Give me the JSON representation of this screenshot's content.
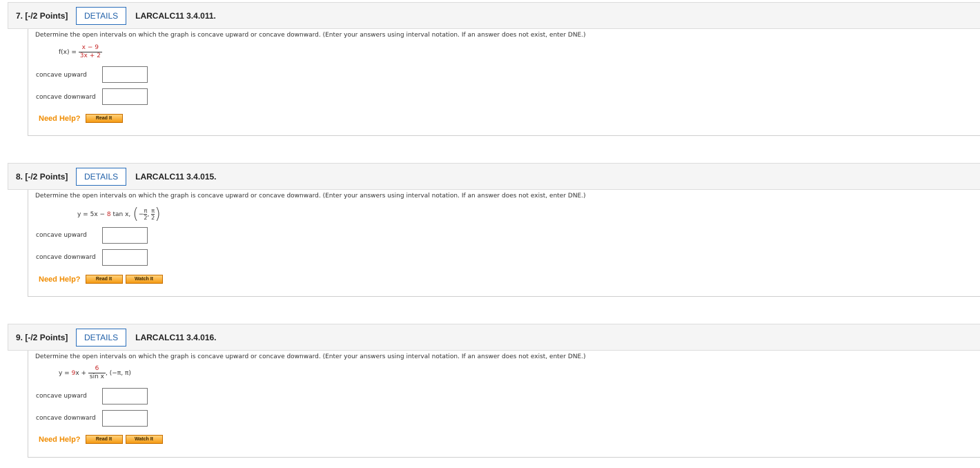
{
  "questions": [
    {
      "number": "7.",
      "points": "[-/2 Points]",
      "details_label": "DETAILS",
      "code": "LARCALC11 3.4.011.",
      "prompt": "Determine the open intervals on which the graph is concave upward or concave downward. (Enter your answers using interval notation. If an answer does not exist, enter DNE.)",
      "formula": {
        "lhs": "f(x) =",
        "numerator": "x − 9",
        "denominator": "3x + 2"
      },
      "labels": {
        "up": "concave upward",
        "down": "concave downward"
      },
      "answers": {
        "up": "",
        "down": ""
      },
      "need_help": "Need Help?",
      "help_buttons": [
        "Read It"
      ]
    },
    {
      "number": "8.",
      "points": "[-/2 Points]",
      "details_label": "DETAILS",
      "code": "LARCALC11 3.4.015.",
      "prompt": "Determine the open intervals on which the graph is concave upward or concave downward. (Enter your answers using interval notation. If an answer does not exist, enter DNE.)",
      "formula": {
        "prefix": "y = 5x − ",
        "coef": "8",
        "suffix": " tan x,",
        "interval_lo_num": "π",
        "interval_lo_den": "2",
        "interval_hi_num": "π",
        "interval_hi_den": "2"
      },
      "labels": {
        "up": "concave upward",
        "down": "concave downward"
      },
      "answers": {
        "up": "",
        "down": ""
      },
      "need_help": "Need Help?",
      "help_buttons": [
        "Read It",
        "Watch It"
      ]
    },
    {
      "number": "9.",
      "points": "[-/2 Points]",
      "details_label": "DETAILS",
      "code": "LARCALC11 3.4.016.",
      "prompt": "Determine the open intervals on which the graph is concave upward or concave downward. (Enter your answers using interval notation. If an answer does not exist, enter DNE.)",
      "formula": {
        "prefix": "y = ",
        "coef": "9",
        "mid": "x + ",
        "numerator": "6",
        "denominator": "sin x",
        "interval": ",   (−π, π)"
      },
      "labels": {
        "up": "concave upward",
        "down": "concave downward"
      },
      "answers": {
        "up": "",
        "down": ""
      },
      "need_help": "Need Help?",
      "help_buttons": [
        "Read It",
        "Watch It"
      ]
    }
  ]
}
